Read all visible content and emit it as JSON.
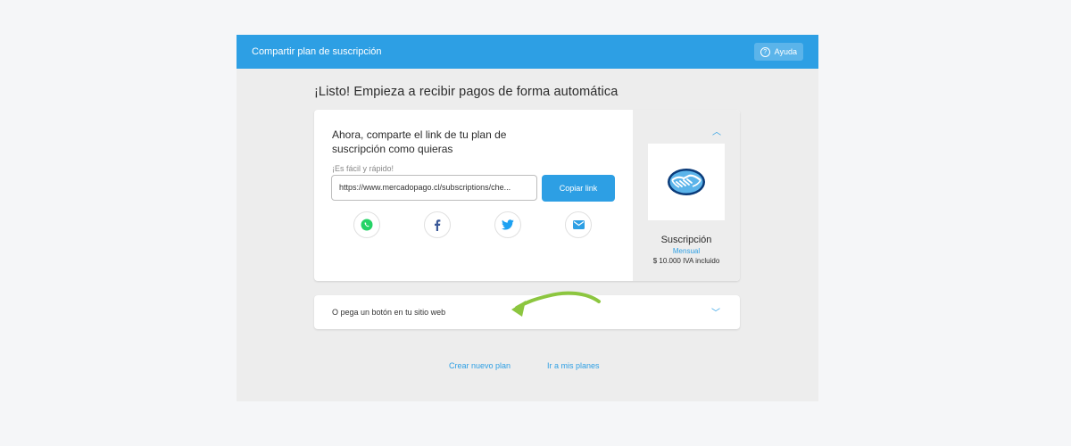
{
  "topbar": {
    "title": "Compartir plan de suscripción",
    "help_label": "Ayuda",
    "help_icon": "question-circle-icon"
  },
  "main": {
    "heading": "¡Listo! Empieza a recibir pagos de forma automática"
  },
  "share_card": {
    "title": "Ahora, comparte el link de tu plan de suscripción como quieras",
    "field_label": "¡Es fácil y rápido!",
    "link_value": "https://www.mercadopago.cl/subscriptions/che...",
    "copy_label": "Copiar link",
    "share_icons": [
      "whatsapp-icon",
      "facebook-icon",
      "twitter-icon",
      "mail-icon"
    ]
  },
  "subscription": {
    "name": "Suscripción",
    "frequency": "Mensual",
    "price": "$ 10.000 IVA incluido"
  },
  "embed": {
    "label": "O pega un botón en tu sitio web"
  },
  "footer": {
    "new_plan": "Crear nuevo plan",
    "my_plans": "Ir a mis planes"
  },
  "colors": {
    "accent": "#2d9fe4",
    "topbar": "#2d9fe4",
    "arrow": "#8cc63f",
    "whatsapp": "#25d366",
    "facebook": "#3b5998",
    "twitter": "#1da1f2"
  }
}
